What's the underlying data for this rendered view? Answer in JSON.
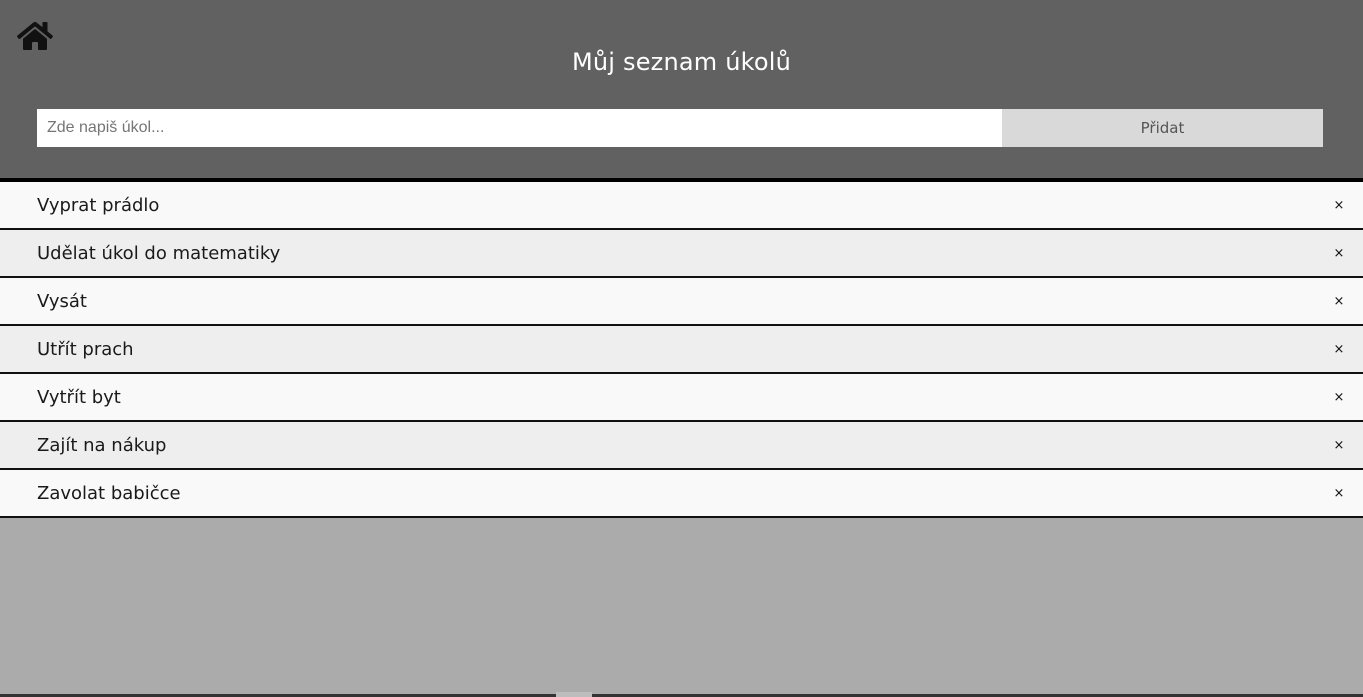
{
  "header": {
    "home_icon": "home-icon",
    "title": "Můj seznam úkolů",
    "input_placeholder": "Zde napiš úkol...",
    "input_value": "",
    "add_label": "Přidat"
  },
  "tasks": [
    {
      "label": "Vyprat prádlo",
      "close": "×"
    },
    {
      "label": "Udělat úkol do matematiky",
      "close": "×"
    },
    {
      "label": "Vysát",
      "close": "×"
    },
    {
      "label": "Utřít prach",
      "close": "×"
    },
    {
      "label": "Vytřít byt",
      "close": "×"
    },
    {
      "label": "Zajít na nákup",
      "close": "×"
    },
    {
      "label": "Zavolat babičce",
      "close": "×"
    }
  ],
  "colors": {
    "header_bg": "#616161",
    "body_bg": "#ababab",
    "row_odd": "#f9f9f9",
    "row_even": "#eeeeee",
    "button_bg": "#d9d9d9"
  }
}
